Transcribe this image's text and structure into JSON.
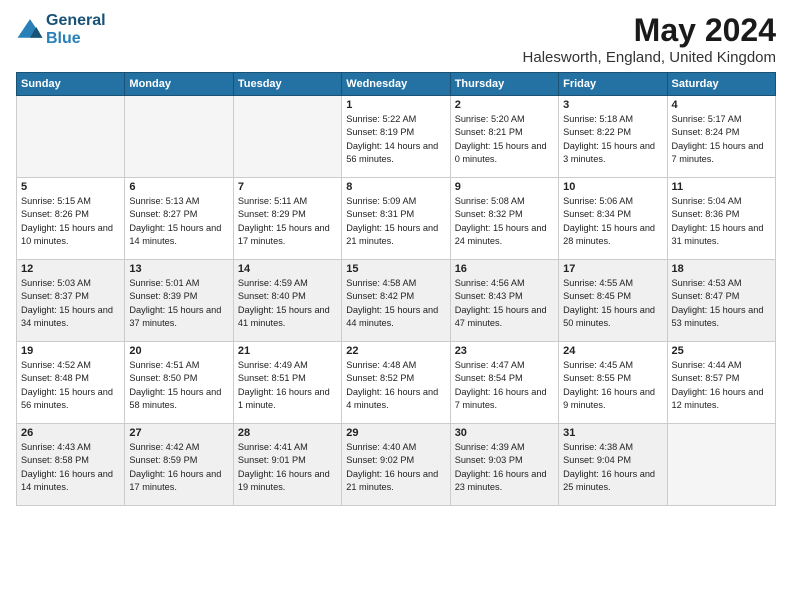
{
  "header": {
    "logo_line1": "General",
    "logo_line2": "Blue",
    "month_title": "May 2024",
    "location": "Halesworth, England, United Kingdom"
  },
  "days_of_week": [
    "Sunday",
    "Monday",
    "Tuesday",
    "Wednesday",
    "Thursday",
    "Friday",
    "Saturday"
  ],
  "weeks": [
    [
      {
        "day": "",
        "empty": true
      },
      {
        "day": "",
        "empty": true
      },
      {
        "day": "",
        "empty": true
      },
      {
        "day": "1",
        "sunrise": "5:22 AM",
        "sunset": "8:19 PM",
        "daylight": "14 hours and 56 minutes."
      },
      {
        "day": "2",
        "sunrise": "5:20 AM",
        "sunset": "8:21 PM",
        "daylight": "15 hours and 0 minutes."
      },
      {
        "day": "3",
        "sunrise": "5:18 AM",
        "sunset": "8:22 PM",
        "daylight": "15 hours and 3 minutes."
      },
      {
        "day": "4",
        "sunrise": "5:17 AM",
        "sunset": "8:24 PM",
        "daylight": "15 hours and 7 minutes."
      }
    ],
    [
      {
        "day": "5",
        "sunrise": "5:15 AM",
        "sunset": "8:26 PM",
        "daylight": "15 hours and 10 minutes."
      },
      {
        "day": "6",
        "sunrise": "5:13 AM",
        "sunset": "8:27 PM",
        "daylight": "15 hours and 14 minutes."
      },
      {
        "day": "7",
        "sunrise": "5:11 AM",
        "sunset": "8:29 PM",
        "daylight": "15 hours and 17 minutes."
      },
      {
        "day": "8",
        "sunrise": "5:09 AM",
        "sunset": "8:31 PM",
        "daylight": "15 hours and 21 minutes."
      },
      {
        "day": "9",
        "sunrise": "5:08 AM",
        "sunset": "8:32 PM",
        "daylight": "15 hours and 24 minutes."
      },
      {
        "day": "10",
        "sunrise": "5:06 AM",
        "sunset": "8:34 PM",
        "daylight": "15 hours and 28 minutes."
      },
      {
        "day": "11",
        "sunrise": "5:04 AM",
        "sunset": "8:36 PM",
        "daylight": "15 hours and 31 minutes."
      }
    ],
    [
      {
        "day": "12",
        "sunrise": "5:03 AM",
        "sunset": "8:37 PM",
        "daylight": "15 hours and 34 minutes."
      },
      {
        "day": "13",
        "sunrise": "5:01 AM",
        "sunset": "8:39 PM",
        "daylight": "15 hours and 37 minutes."
      },
      {
        "day": "14",
        "sunrise": "4:59 AM",
        "sunset": "8:40 PM",
        "daylight": "15 hours and 41 minutes."
      },
      {
        "day": "15",
        "sunrise": "4:58 AM",
        "sunset": "8:42 PM",
        "daylight": "15 hours and 44 minutes."
      },
      {
        "day": "16",
        "sunrise": "4:56 AM",
        "sunset": "8:43 PM",
        "daylight": "15 hours and 47 minutes."
      },
      {
        "day": "17",
        "sunrise": "4:55 AM",
        "sunset": "8:45 PM",
        "daylight": "15 hours and 50 minutes."
      },
      {
        "day": "18",
        "sunrise": "4:53 AM",
        "sunset": "8:47 PM",
        "daylight": "15 hours and 53 minutes."
      }
    ],
    [
      {
        "day": "19",
        "sunrise": "4:52 AM",
        "sunset": "8:48 PM",
        "daylight": "15 hours and 56 minutes."
      },
      {
        "day": "20",
        "sunrise": "4:51 AM",
        "sunset": "8:50 PM",
        "daylight": "15 hours and 58 minutes."
      },
      {
        "day": "21",
        "sunrise": "4:49 AM",
        "sunset": "8:51 PM",
        "daylight": "16 hours and 1 minute."
      },
      {
        "day": "22",
        "sunrise": "4:48 AM",
        "sunset": "8:52 PM",
        "daylight": "16 hours and 4 minutes."
      },
      {
        "day": "23",
        "sunrise": "4:47 AM",
        "sunset": "8:54 PM",
        "daylight": "16 hours and 7 minutes."
      },
      {
        "day": "24",
        "sunrise": "4:45 AM",
        "sunset": "8:55 PM",
        "daylight": "16 hours and 9 minutes."
      },
      {
        "day": "25",
        "sunrise": "4:44 AM",
        "sunset": "8:57 PM",
        "daylight": "16 hours and 12 minutes."
      }
    ],
    [
      {
        "day": "26",
        "sunrise": "4:43 AM",
        "sunset": "8:58 PM",
        "daylight": "16 hours and 14 minutes."
      },
      {
        "day": "27",
        "sunrise": "4:42 AM",
        "sunset": "8:59 PM",
        "daylight": "16 hours and 17 minutes."
      },
      {
        "day": "28",
        "sunrise": "4:41 AM",
        "sunset": "9:01 PM",
        "daylight": "16 hours and 19 minutes."
      },
      {
        "day": "29",
        "sunrise": "4:40 AM",
        "sunset": "9:02 PM",
        "daylight": "16 hours and 21 minutes."
      },
      {
        "day": "30",
        "sunrise": "4:39 AM",
        "sunset": "9:03 PM",
        "daylight": "16 hours and 23 minutes."
      },
      {
        "day": "31",
        "sunrise": "4:38 AM",
        "sunset": "9:04 PM",
        "daylight": "16 hours and 25 minutes."
      },
      {
        "day": "",
        "empty": true
      }
    ]
  ],
  "labels": {
    "sunrise": "Sunrise:",
    "sunset": "Sunset:",
    "daylight": "Daylight:"
  }
}
